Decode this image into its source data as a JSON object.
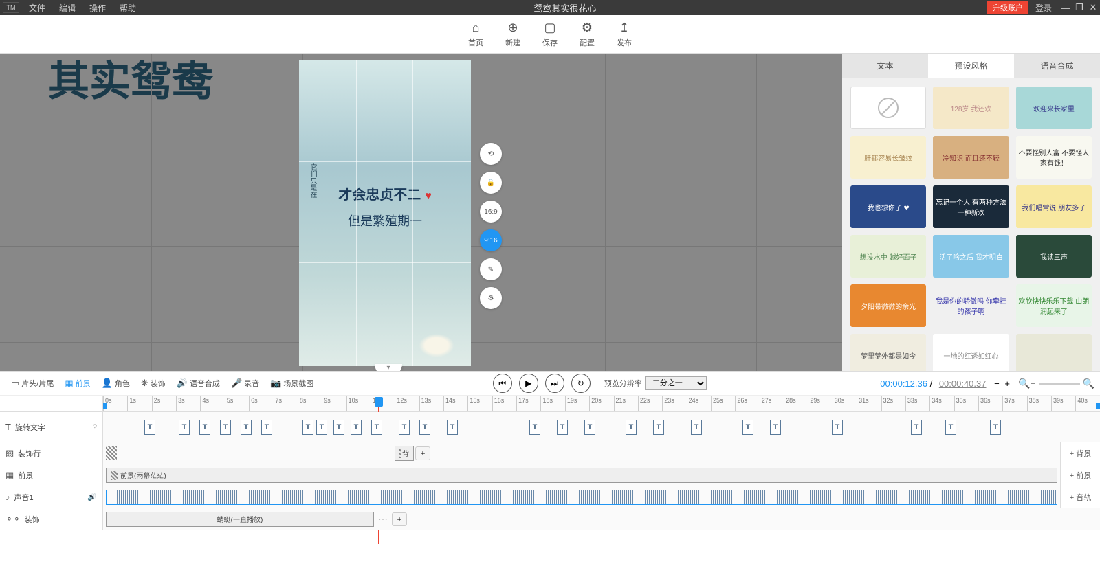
{
  "title": "鸳鸯其实很花心",
  "menus": [
    "文件",
    "编辑",
    "操作",
    "帮助"
  ],
  "upgrade": "升级账户",
  "login": "登录",
  "toolbar": [
    {
      "icon": "⌂",
      "label": "首页"
    },
    {
      "icon": "⊕",
      "label": "新建"
    },
    {
      "icon": "▢",
      "label": "保存"
    },
    {
      "icon": "⚙",
      "label": "配置"
    },
    {
      "icon": "↥",
      "label": "发布"
    }
  ],
  "canvas": {
    "bg_text": "其实鸳鸯",
    "vtext": "它们只是在",
    "line1": "才会忠贞不二",
    "line2": "但是繁殖期一",
    "tools": [
      {
        "ic": "⟲",
        "active": false
      },
      {
        "ic": "🔓",
        "active": false
      },
      {
        "ic": "16:9",
        "active": false
      },
      {
        "ic": "9:16",
        "active": true
      },
      {
        "ic": "✎",
        "active": false
      },
      {
        "ic": "⚙",
        "active": false
      }
    ]
  },
  "right_tabs": [
    "文本",
    "预设风格",
    "语音合成"
  ],
  "right_active": 1,
  "presets": [
    {
      "bg": "#fff",
      "c": "#999",
      "t": "",
      "none": true
    },
    {
      "bg": "#f5e8c8",
      "c": "#b88",
      "t": "128岁 我还欢"
    },
    {
      "bg": "#a8d8d8",
      "c": "#338",
      "t": "欢迎来长家里"
    },
    {
      "bg": "#f8f0d0",
      "c": "#a85",
      "t": "肝都容易长皱纹"
    },
    {
      "bg": "#d8b080",
      "c": "#833",
      "t": "冷知识 而且还不轻"
    },
    {
      "bg": "#f8f8f0",
      "c": "#333",
      "t": "不要怪别人富 不要怪人家有钱！"
    },
    {
      "bg": "#2a4a8a",
      "c": "#fff",
      "t": "我也想你了 ❤"
    },
    {
      "bg": "#1a2a3a",
      "c": "#fff",
      "t": "忘记一个人 有两种方法 一种新欢"
    },
    {
      "bg": "#f8e8a0",
      "c": "#338",
      "t": "我们唱常说 朋友多了"
    },
    {
      "bg": "#e8f0d8",
      "c": "#585",
      "t": "想没水中 越好面子"
    },
    {
      "bg": "#88c8e8",
      "c": "#fff",
      "t": "活了啥之后 我才明白"
    },
    {
      "bg": "#2a4a3a",
      "c": "#fff",
      "t": "我读三声"
    },
    {
      "bg": "#e88830",
      "c": "#fff",
      "t": "夕阳带微微的余光"
    },
    {
      "bg": "#f0f0f0",
      "c": "#33a",
      "t": "我是你的骄傲吗 你牵挂的孩子啊"
    },
    {
      "bg": "#e8f5e8",
      "c": "#383",
      "t": "欢欣快快乐乐下载 山朗润起来了"
    },
    {
      "bg": "#f0ede0",
      "c": "#555",
      "t": "梦里梦外都是如今"
    },
    {
      "bg": "#fff",
      "c": "#888",
      "t": "一地的红透如红心"
    },
    {
      "bg": "#e8e8d8",
      "c": "#686",
      "t": ""
    }
  ],
  "tl_tabs": [
    {
      "ic": "▭",
      "label": "片头/片尾"
    },
    {
      "ic": "▦",
      "label": "前景"
    },
    {
      "ic": "👤",
      "label": "角色"
    },
    {
      "ic": "❋",
      "label": "装饰"
    },
    {
      "ic": "🔊",
      "label": "语音合成"
    },
    {
      "ic": "🎤",
      "label": "录音"
    },
    {
      "ic": "📷",
      "label": "场景截图"
    }
  ],
  "tl_active": 1,
  "res_label": "预览分辨率",
  "res_value": "二分之一",
  "time_cur": "00:00:12.36",
  "time_tot": "00:00:40.37",
  "ticks": [
    "0s",
    "1s",
    "2s",
    "3s",
    "4s",
    "5s",
    "6s",
    "7s",
    "8s",
    "9s",
    "10s",
    "11s",
    "12s",
    "13s",
    "14s",
    "15s",
    "16s",
    "17s",
    "18s",
    "19s",
    "20s",
    "21s",
    "22s",
    "23s",
    "24s",
    "25s",
    "26s",
    "27s",
    "28s",
    "29s",
    "30s",
    "31s",
    "32s",
    "33s",
    "34s",
    "35s",
    "36s",
    "37s",
    "38s",
    "39s",
    "40s"
  ],
  "tracks": {
    "rotate_text": "旋转文字",
    "bg_row": "装饰行",
    "bg_add": "+ 背景",
    "fg_row": "前景",
    "fg_clip": "前景(雨幕茫茫)",
    "fg_add": "+ 前景",
    "audio_row": "声音1",
    "audio_add": "+ 音轨",
    "deco_row": "装饰",
    "deco_clip": "蜻蜓(一直播放)",
    "bg_clip2": "背"
  },
  "text_positions": [
    60,
    110,
    140,
    170,
    200,
    230,
    290,
    310,
    335,
    360,
    390,
    430,
    460,
    500,
    620,
    660,
    700,
    760,
    800,
    855,
    930,
    970,
    1060,
    1175,
    1225,
    1290
  ]
}
